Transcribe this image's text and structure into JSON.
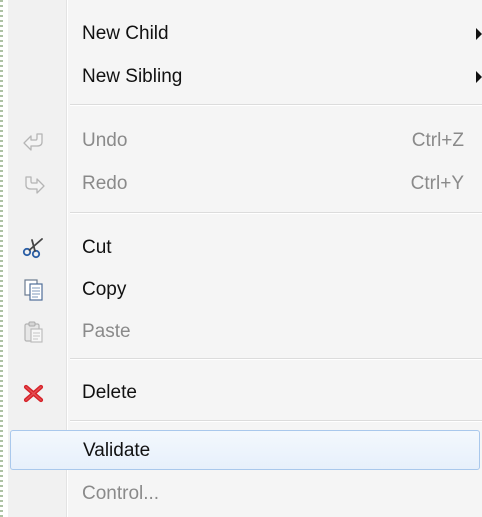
{
  "menu": {
    "items": [
      {
        "label": "New Child",
        "submenu": true
      },
      {
        "label": "New Sibling",
        "submenu": true
      },
      {
        "label": "Undo",
        "shortcut": "Ctrl+Z",
        "icon": "undo-icon",
        "disabled": true
      },
      {
        "label": "Redo",
        "shortcut": "Ctrl+Y",
        "icon": "redo-icon",
        "disabled": true
      },
      {
        "label": "Cut",
        "icon": "scissors-icon"
      },
      {
        "label": "Copy",
        "icon": "copy-icon"
      },
      {
        "label": "Paste",
        "icon": "paste-icon",
        "disabled": true
      },
      {
        "label": "Delete",
        "icon": "delete-icon"
      },
      {
        "label": "Validate",
        "highlighted": true
      },
      {
        "label": "Control...",
        "disabled": true
      }
    ]
  },
  "colors": {
    "highlight_border": "#a9c8ec",
    "delete_red": "#d6232a",
    "disabled_text": "#8a8a8a"
  }
}
